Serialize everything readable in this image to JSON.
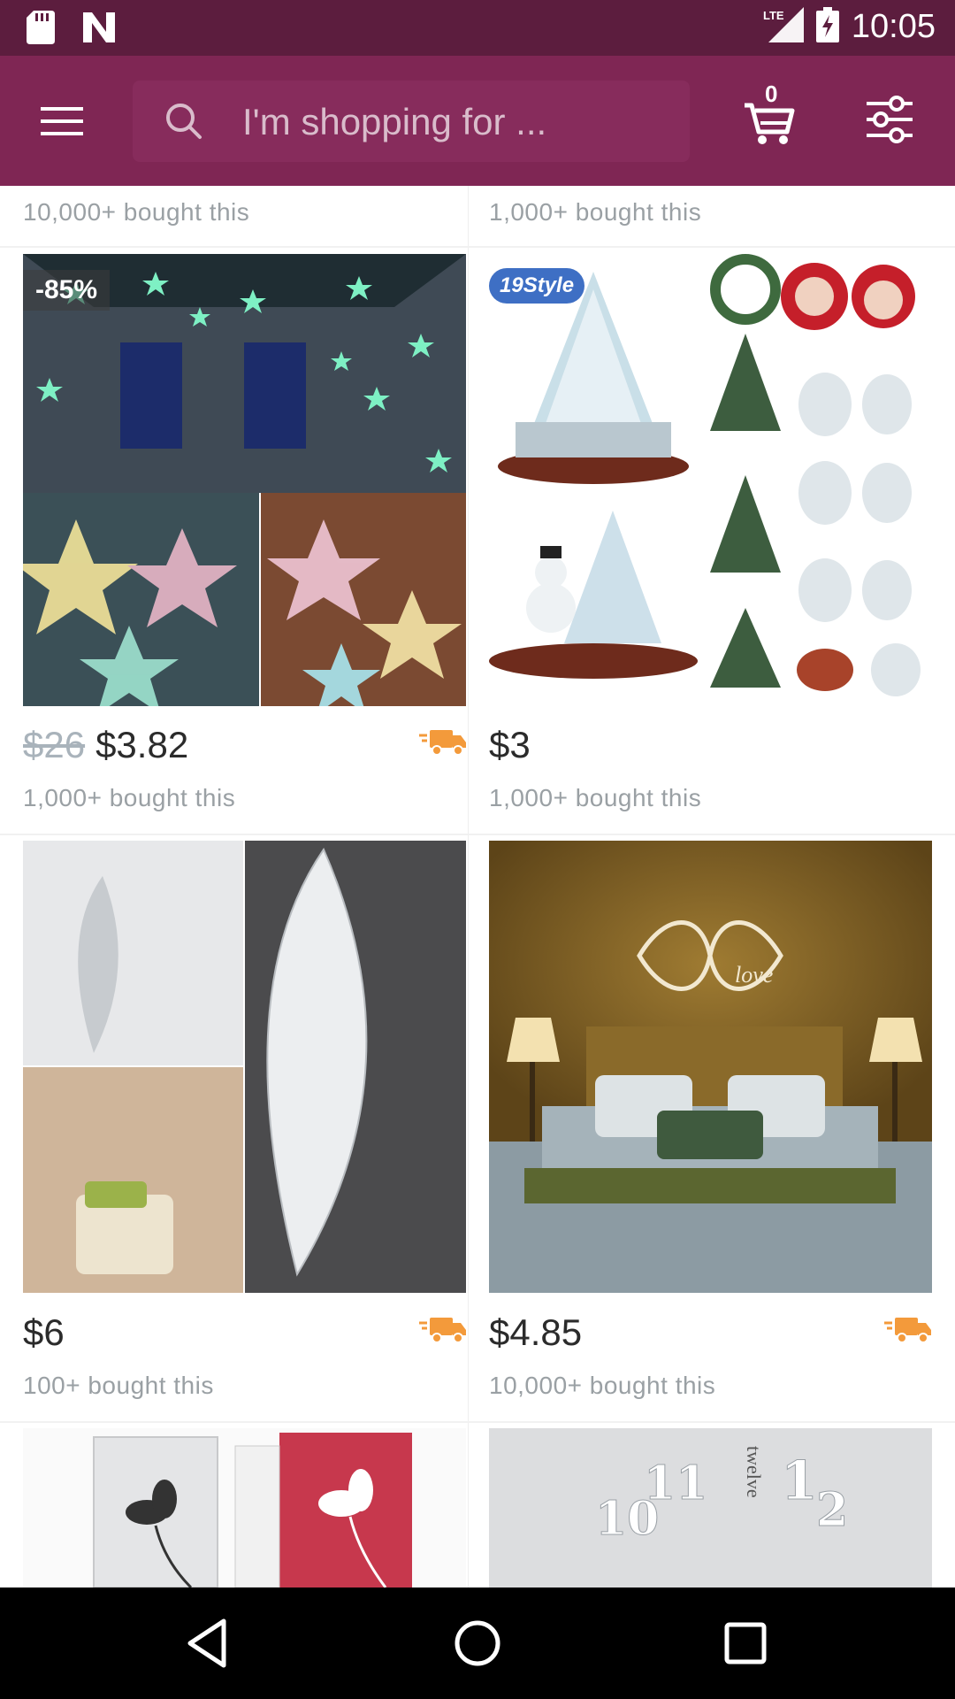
{
  "status_bar": {
    "network": "LTE",
    "time": "10:05"
  },
  "search": {
    "placeholder": "I'm shopping for ..."
  },
  "cart": {
    "count": "0"
  },
  "feed": {
    "top_row": {
      "left_bought": "10,000+ bought this",
      "right_bought": "1,000+ bought this"
    },
    "products": [
      {
        "badge": "-85%",
        "original_price": "$26",
        "price": "$3.82",
        "bought": "1,000+ bought this",
        "free_shipping": true
      },
      {
        "badge": "19Style",
        "price": "$3",
        "bought": "1,000+ bought this",
        "free_shipping": false
      },
      {
        "price": "$6",
        "bought": "100+ bought this",
        "free_shipping": true
      },
      {
        "price": "$4.85",
        "bought": "10,000+ bought this",
        "free_shipping": true
      },
      {
        "image_text": "11 1 2 10"
      },
      {
        "image_text": "twelve"
      }
    ],
    "image_overlay_text": "love"
  },
  "colors": {
    "status_bar": "#5c1d3e",
    "app_bar": "#7f2654",
    "shipping_truck": "#f39a3b"
  }
}
